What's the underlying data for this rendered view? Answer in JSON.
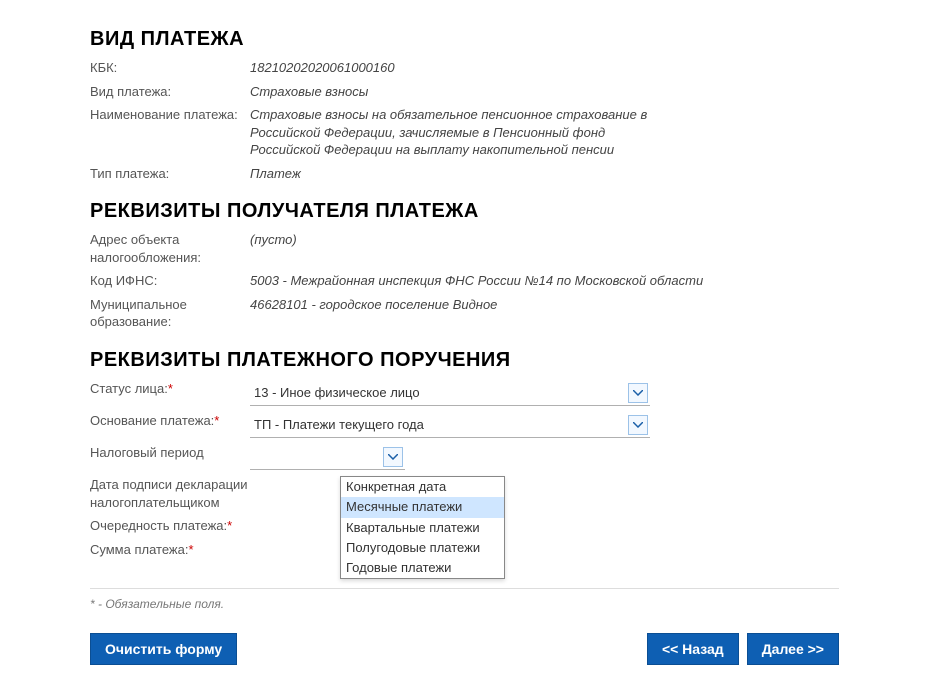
{
  "sections": {
    "payment_type": {
      "title": "ВИД ПЛАТЕЖА",
      "kbk_label": "КБК:",
      "kbk_value": "18210202020061000160",
      "type_label": "Вид платежа:",
      "type_value": "Страховые взносы",
      "name_label": "Наименование платежа:",
      "name_value": "Страховые взносы на обязательное пенсионное страхование в Российской Федерации, зачисляемые в Пенсионный фонд Российской Федерации на выплату накопительной пенсии",
      "tip_label": "Тип платежа:",
      "tip_value": "Платеж"
    },
    "recipient": {
      "title": "РЕКВИЗИТЫ ПОЛУЧАТЕЛЯ ПЛАТЕЖА",
      "addr_label": "Адрес объекта налогообложения:",
      "addr_value": "(пусто)",
      "ifns_label": "Код ИФНС:",
      "ifns_value": "5003 - Межрайонная инспекция ФНС России №14 по Московской области",
      "mun_label": "Муниципальное образование:",
      "mun_value": "46628101 - городское поселение Видное"
    },
    "order": {
      "title": "РЕКВИЗИТЫ ПЛАТЕЖНОГО ПОРУЧЕНИЯ",
      "status_label": "Статус лица:",
      "status_value": "13 - Иное физическое лицо",
      "basis_label": "Основание платежа:",
      "basis_value": "ТП - Платежи текущего года",
      "period_label": "Налоговый период",
      "period_value": "",
      "period_options": [
        "Конкретная дата",
        "Месячные платежи",
        "Квартальные платежи",
        "Полугодовые платежи",
        "Годовые платежи"
      ],
      "signdate_label": "Дата подписи декларации налогоплательщиком",
      "priority_label": "Очередность платежа:",
      "amount_label": "Сумма платежа:"
    }
  },
  "footnote": "* - Обязательные поля.",
  "buttons": {
    "clear": "Очистить форму",
    "back": "<< Назад",
    "next": "Далее >>"
  }
}
